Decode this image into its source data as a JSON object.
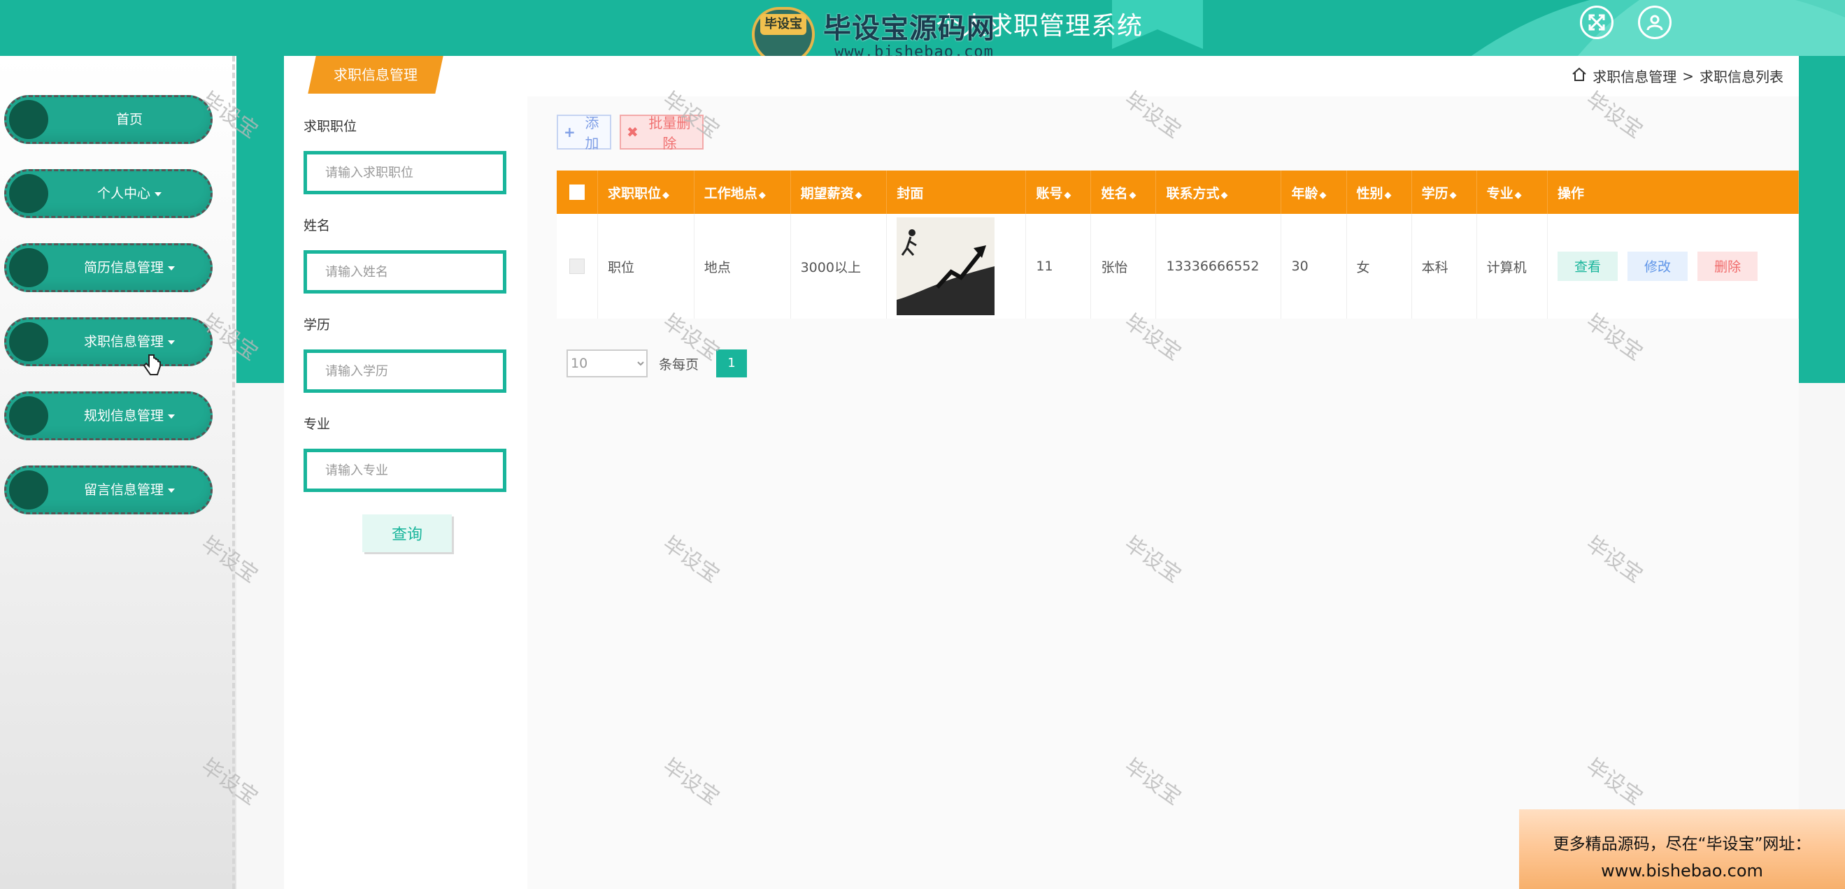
{
  "header": {
    "title": "个人求职管理系统",
    "icons": [
      "fullscreen-icon",
      "user-icon"
    ]
  },
  "logo": {
    "badge": "毕设宝",
    "name": "毕设宝源码网",
    "url": "www.bishebao.com"
  },
  "sidebar": {
    "items": [
      {
        "label": "首页",
        "has_caret": false
      },
      {
        "label": "个人中心",
        "has_caret": true
      },
      {
        "label": "简历信息管理",
        "has_caret": true
      },
      {
        "label": "求职信息管理",
        "has_caret": true
      },
      {
        "label": "规划信息管理",
        "has_caret": true
      },
      {
        "label": "留言信息管理",
        "has_caret": true
      }
    ]
  },
  "panel": {
    "tab_label": "求职信息管理"
  },
  "breadcrumb": {
    "parent": "求职信息管理",
    "separator": ">",
    "current": "求职信息列表"
  },
  "search": {
    "fields": [
      {
        "label": "求职职位",
        "placeholder": "请输入求职职位"
      },
      {
        "label": "姓名",
        "placeholder": "请输入姓名"
      },
      {
        "label": "学历",
        "placeholder": "请输入学历"
      },
      {
        "label": "专业",
        "placeholder": "请输入专业"
      }
    ],
    "submit_label": "查询"
  },
  "toolbar": {
    "add_label": "添加",
    "batch_delete_label": "批量删除"
  },
  "table": {
    "columns": [
      "求职职位",
      "工作地点",
      "期望薪资",
      "封面",
      "账号",
      "姓名",
      "联系方式",
      "年龄",
      "性别",
      "学历",
      "专业",
      "操作"
    ],
    "rows": [
      {
        "position": "职位",
        "location": "地点",
        "salary": "3000以上",
        "account": "11",
        "name": "张怡",
        "phone": "13336666552",
        "age": "30",
        "gender": "女",
        "education": "本科",
        "major": "计算机"
      }
    ],
    "actions": {
      "view": "查看",
      "edit": "修改",
      "delete": "删除"
    }
  },
  "pagination": {
    "page_size": "10",
    "per_page_label": "条每页",
    "current_page": "1"
  },
  "watermark": "毕设宝",
  "ad": {
    "line1": "更多精品源码，尽在“毕设宝”网址：",
    "line2": "www.bishebao.com"
  },
  "colors": {
    "primary": "#19b59b",
    "table_header": "#f7920a",
    "sidebar_item": "#1fa890"
  }
}
